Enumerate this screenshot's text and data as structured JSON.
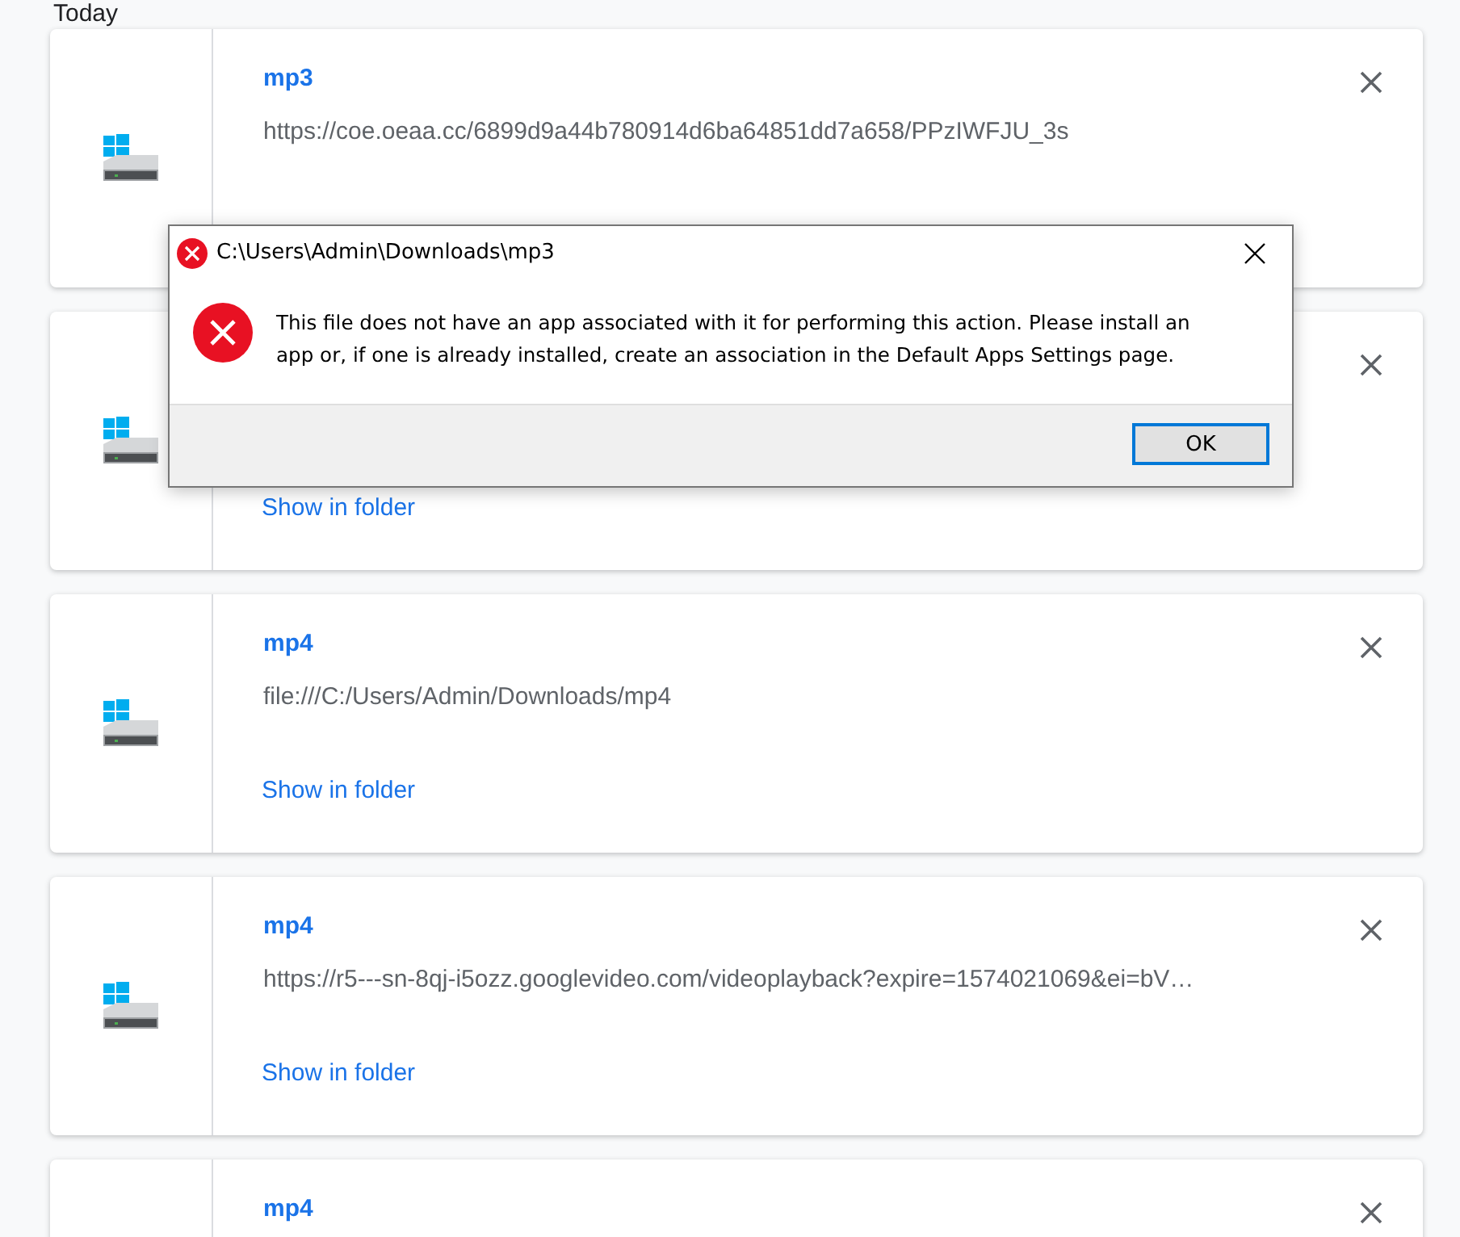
{
  "section_heading": "Today",
  "downloads": [
    {
      "title": "mp3",
      "url": "https://coe.oeaa.cc/6899d9a44b780914d6ba64851dd7a658/PPzIWFJU_3s"
    },
    {
      "link": "Show in folder"
    },
    {
      "title": "mp4",
      "url": "file:///C:/Users/Admin/Downloads/mp4",
      "link": "Show in folder"
    },
    {
      "title": "mp4",
      "url": "https://r5---sn-8qj-i5ozz.googlevideo.com/videoplayback?expire=1574021069&ei=bV…",
      "link": "Show in folder"
    },
    {
      "title": "mp4"
    }
  ],
  "dialog": {
    "title": "C:\\Users\\Admin\\Downloads\\mp3",
    "message": "This file does not have an app associated with it for performing this action. Please install an app or, if one is already installed, create an association in the Default Apps Settings page.",
    "buttons": [
      "OK"
    ]
  }
}
